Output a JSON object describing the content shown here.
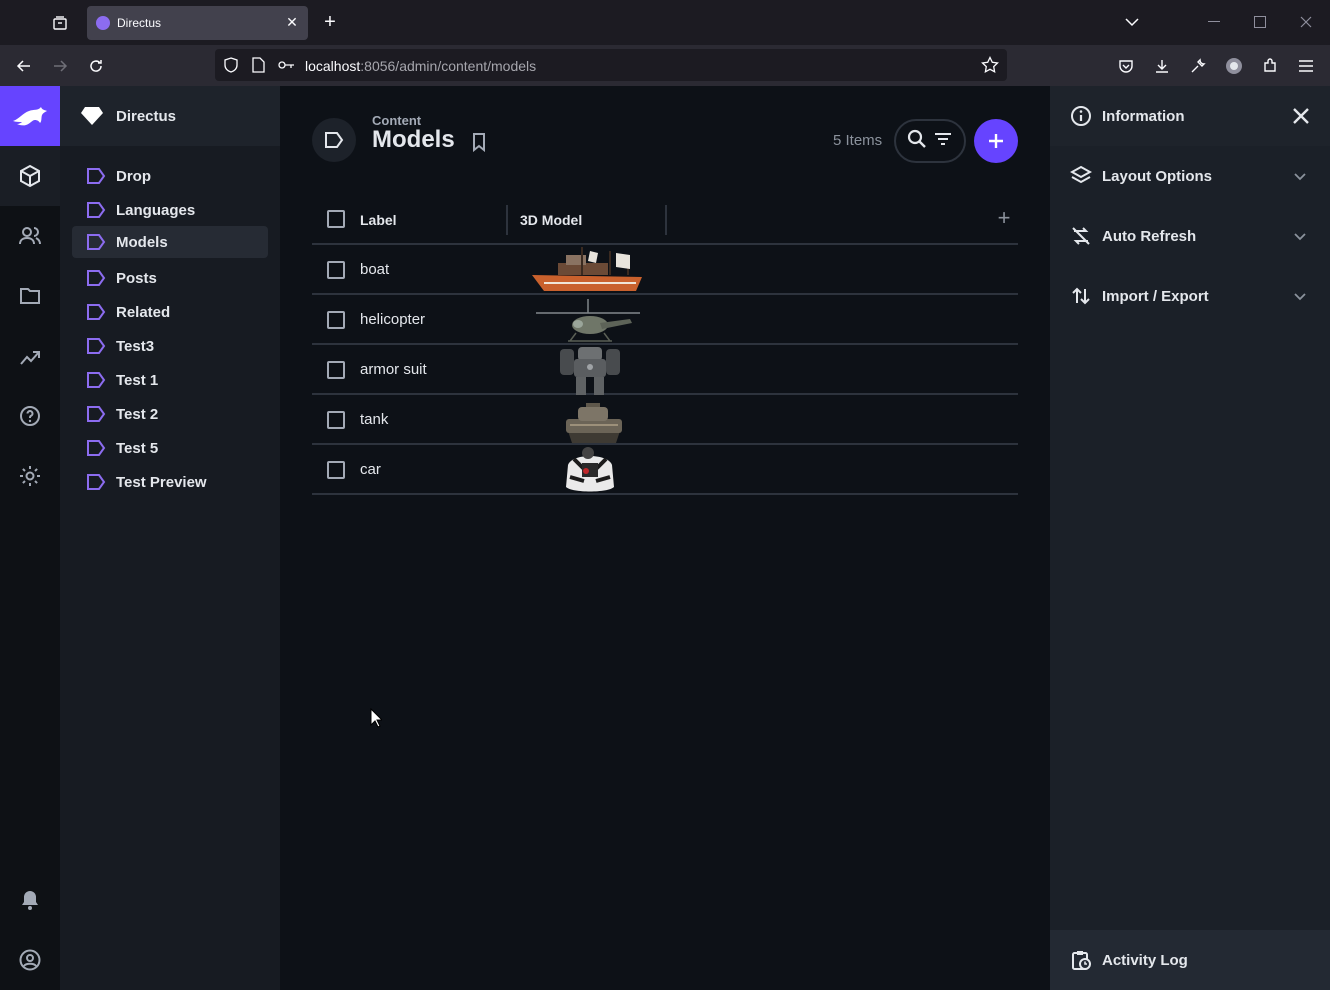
{
  "browser": {
    "tab_title": "Directus",
    "url_host": "localhost",
    "url_path": ":8056/admin/content/models"
  },
  "project": {
    "name": "Directus"
  },
  "nav": {
    "items": [
      {
        "label": "Drop"
      },
      {
        "label": "Languages"
      },
      {
        "label": "Models"
      },
      {
        "label": "Posts"
      },
      {
        "label": "Related"
      },
      {
        "label": "Test3"
      },
      {
        "label": "Test 1"
      },
      {
        "label": "Test 2"
      },
      {
        "label": "Test 5"
      },
      {
        "label": "Test Preview"
      }
    ],
    "active": "Models"
  },
  "header": {
    "breadcrumb": "Content",
    "title": "Models",
    "items_count": "5 Items"
  },
  "table": {
    "columns": [
      "Label",
      "3D Model"
    ],
    "rows": [
      {
        "label": "boat"
      },
      {
        "label": "helicopter"
      },
      {
        "label": "armor suit"
      },
      {
        "label": "tank"
      },
      {
        "label": "car"
      }
    ]
  },
  "sidebar": {
    "information": "Information",
    "layout_options": "Layout Options",
    "auto_refresh": "Auto Refresh",
    "import_export": "Import / Export",
    "activity_log": "Activity Log"
  },
  "colors": {
    "accent": "#6644ff",
    "background": "#0d1117"
  }
}
